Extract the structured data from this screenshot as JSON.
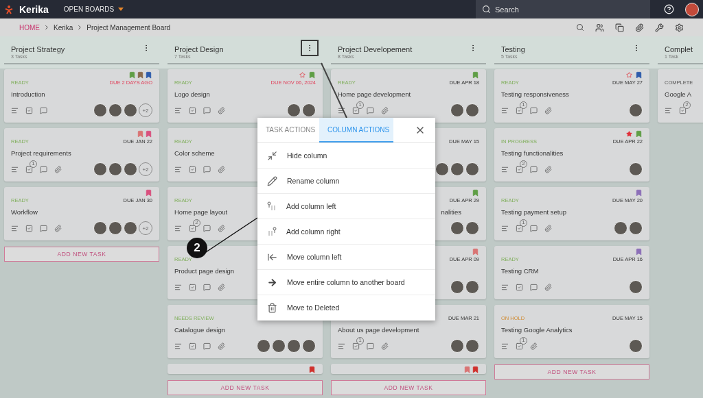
{
  "topbar": {
    "brand": "Kerika",
    "boards_menu": "OPEN BOARDS",
    "search": {
      "placeholder": "Search"
    }
  },
  "breadcrumb": [
    {
      "label": "HOME",
      "kind": "link"
    },
    {
      "label": "Kerika",
      "kind": "plain"
    },
    {
      "label": "Project Management Board",
      "kind": "plain"
    }
  ],
  "columns": [
    {
      "title": "Project Strategy",
      "count": "3 Tasks",
      "highlighted": false,
      "add_button": "ADD NEW TASK",
      "cards": [
        {
          "kind": "full",
          "bookmarks": [
            {
              "color": "#5f9e45"
            },
            {
              "color": "#8a6a4c"
            },
            {
              "color": "#2d5bab"
            }
          ],
          "status": {
            "label": "READY",
            "kind": "active"
          },
          "due": "DUE 2 DAYS AGO",
          "overdue": true,
          "title": "Introduction",
          "icons": [
            {
              "kind": "notes"
            },
            {
              "kind": "checklist"
            },
            {
              "kind": "chat"
            }
          ],
          "avatars": [
            {
              "kind": "photo"
            },
            {
              "kind": "photo"
            },
            {
              "kind": "photo"
            }
          ],
          "more": "+2"
        },
        {
          "kind": "full",
          "bookmarks": [
            {
              "color": "#d97474"
            },
            {
              "color": "#d9507e"
            }
          ],
          "status": {
            "label": "READY",
            "kind": "active"
          },
          "due": "DUE JAN 22",
          "overdue": false,
          "title": "Project requirements",
          "icons": [
            {
              "kind": "notes"
            },
            {
              "kind": "checklist"
            },
            {
              "kind": "chat"
            },
            {
              "kind": "attachment"
            }
          ],
          "checklist_count": "1",
          "avatars": [
            {
              "kind": "photo"
            },
            {
              "kind": "photo"
            },
            {
              "kind": "photo"
            }
          ],
          "more": "+2"
        },
        {
          "kind": "full",
          "bookmarks": [
            {
              "color": "#d9507e"
            }
          ],
          "status": {
            "label": "READY",
            "kind": "active"
          },
          "due": "DUE JAN 30",
          "overdue": false,
          "title": "Workflow",
          "icons": [
            {
              "kind": "notes"
            },
            {
              "kind": "checklist"
            },
            {
              "kind": "chat"
            },
            {
              "kind": "attachment"
            }
          ],
          "avatars": [
            {
              "kind": "photo"
            },
            {
              "kind": "photo"
            },
            {
              "kind": "photo"
            }
          ],
          "more": "+2"
        }
      ]
    },
    {
      "title": "Project Design",
      "count": "7 Tasks",
      "highlighted": true,
      "add_button": "ADD NEW TASK",
      "cards": [
        {
          "kind": "full",
          "star": {
            "kind": "outline"
          },
          "bookmarks": [
            {
              "color": "#5f9e45"
            }
          ],
          "status": {
            "label": "READY",
            "kind": "active"
          },
          "due": "DUE NOV 06, 2024",
          "overdue": true,
          "title": "Logo design",
          "icons": [
            {
              "kind": "notes"
            },
            {
              "kind": "checklist"
            },
            {
              "kind": "chat"
            },
            {
              "kind": "attachment"
            }
          ],
          "avatars": [
            {
              "kind": "photo"
            },
            {
              "kind": "photo"
            }
          ]
        },
        {
          "kind": "full",
          "status": {
            "label": "READY",
            "kind": "active"
          },
          "title": "Color scheme",
          "icons": [
            {
              "kind": "notes"
            },
            {
              "kind": "checklist"
            },
            {
              "kind": "chat"
            },
            {
              "kind": "attachment"
            }
          ]
        },
        {
          "kind": "full",
          "status": {
            "label": "READY",
            "kind": "active"
          },
          "title": "Home page layout",
          "icons": [
            {
              "kind": "notes"
            },
            {
              "kind": "checklist"
            },
            {
              "kind": "chat"
            },
            {
              "kind": "attachment"
            }
          ],
          "checklist_count": "2"
        },
        {
          "kind": "full",
          "status": {
            "label": "READY",
            "kind": "active"
          },
          "title": "Product page design",
          "icons": [
            {
              "kind": "notes"
            },
            {
              "kind": "checklist"
            },
            {
              "kind": "chat"
            },
            {
              "kind": "attachment"
            }
          ]
        },
        {
          "kind": "full",
          "status": {
            "label": "NEEDS REVIEW",
            "kind": "active"
          },
          "title": "Catalogue design",
          "icons": [
            {
              "kind": "notes"
            },
            {
              "kind": "checklist"
            },
            {
              "kind": "chat"
            },
            {
              "kind": "attachment"
            }
          ],
          "avatars": [
            {
              "kind": "photo"
            },
            {
              "kind": "photo"
            },
            {
              "kind": "photo"
            },
            {
              "kind": "photo"
            }
          ]
        },
        {
          "kind": "partial",
          "bookmarks": [
            {
              "color": "#d0312d"
            }
          ]
        }
      ]
    },
    {
      "title": "Project Developement",
      "count": "8 Tasks",
      "highlighted": false,
      "add_button": "ADD NEW TASK",
      "cards": [
        {
          "kind": "full",
          "bookmarks": [
            {
              "color": "#5f9e45"
            }
          ],
          "status": {
            "label": "READY",
            "kind": "active"
          },
          "due": "DUE APR 18",
          "overdue": false,
          "title": "Home page development",
          "icons": [
            {
              "kind": "notes"
            },
            {
              "kind": "checklist"
            },
            {
              "kind": "chat"
            },
            {
              "kind": "attachment"
            }
          ],
          "checklist_count": "1",
          "avatars": [
            {
              "kind": "photo"
            },
            {
              "kind": "photo"
            }
          ]
        },
        {
          "kind": "full",
          "due": "DUE MAY 15",
          "overdue": false,
          "avatars": [
            {
              "kind": "photo"
            },
            {
              "kind": "photo"
            },
            {
              "kind": "photo"
            }
          ]
        },
        {
          "kind": "full",
          "bookmarks": [
            {
              "color": "#5f9e45"
            }
          ],
          "due": "DUE APR 29",
          "overdue": false,
          "title_tail": "nalities",
          "avatars": [
            {
              "kind": "photo"
            },
            {
              "kind": "photo"
            }
          ]
        },
        {
          "kind": "full",
          "bookmarks": [
            {
              "color": "#d97474"
            }
          ],
          "due": "DUE APR 09",
          "overdue": false,
          "avatars": [
            {
              "kind": "photo"
            },
            {
              "kind": "photo"
            }
          ]
        },
        {
          "kind": "full",
          "due": "DUE MAR 21",
          "overdue": false,
          "title": "About us page development",
          "icons": [
            {
              "kind": "notes"
            },
            {
              "kind": "checklist"
            },
            {
              "kind": "chat"
            },
            {
              "kind": "attachment"
            }
          ],
          "checklist_count": "1",
          "avatars": [
            {
              "kind": "photo"
            },
            {
              "kind": "photo"
            }
          ]
        },
        {
          "kind": "partial",
          "bookmarks": [
            {
              "color": "#d97474"
            },
            {
              "color": "#d0312d"
            }
          ]
        }
      ]
    },
    {
      "title": "Testing",
      "count": "5 Tasks",
      "highlighted": false,
      "add_button": "ADD NEW TASK",
      "cards": [
        {
          "kind": "full",
          "star": {
            "kind": "outline"
          },
          "bookmarks": [
            {
              "color": "#2d5bab"
            }
          ],
          "status": {
            "label": "READY",
            "kind": "active"
          },
          "due": "DUE MAY 27",
          "overdue": false,
          "title": "Testing responsiveness",
          "icons": [
            {
              "kind": "notes"
            },
            {
              "kind": "checklist"
            },
            {
              "kind": "chat"
            },
            {
              "kind": "attachment"
            }
          ],
          "checklist_count": "1",
          "avatars": [
            {
              "kind": "photo"
            }
          ]
        },
        {
          "kind": "full",
          "star": {
            "kind": "filled"
          },
          "bookmarks": [
            {
              "color": "#5f9e45"
            }
          ],
          "status": {
            "label": "IN PROGRESS",
            "kind": "active"
          },
          "due": "DUE APR 22",
          "overdue": false,
          "title": "Testing functionalities",
          "icons": [
            {
              "kind": "notes"
            },
            {
              "kind": "checklist"
            },
            {
              "kind": "chat"
            },
            {
              "kind": "attachment"
            }
          ],
          "checklist_count": "2",
          "avatars": [
            {
              "kind": "photo"
            }
          ]
        },
        {
          "kind": "full",
          "bookmarks": [
            {
              "color": "#8c6fb8"
            }
          ],
          "status": {
            "label": "READY",
            "kind": "active"
          },
          "due": "DUE MAY 20",
          "overdue": false,
          "title": "Testing payment setup",
          "icons": [
            {
              "kind": "notes"
            },
            {
              "kind": "checklist"
            },
            {
              "kind": "chat"
            },
            {
              "kind": "attachment"
            }
          ],
          "checklist_count": "1",
          "avatars": [
            {
              "kind": "photo"
            },
            {
              "kind": "photo"
            }
          ]
        },
        {
          "kind": "full",
          "bookmarks": [
            {
              "color": "#8c6fb8"
            }
          ],
          "status": {
            "label": "READY",
            "kind": "active"
          },
          "due": "DUE APR 16",
          "overdue": false,
          "title": "Testing CRM",
          "icons": [
            {
              "kind": "notes"
            },
            {
              "kind": "checklist"
            },
            {
              "kind": "chat"
            },
            {
              "kind": "attachment"
            }
          ],
          "avatars": [
            {
              "kind": "photo"
            }
          ]
        },
        {
          "kind": "full",
          "status": {
            "label": "ON HOLD",
            "kind": "hold"
          },
          "due": "DUE MAY 15",
          "overdue": false,
          "title": "Testing Google Analytics",
          "icons": [
            {
              "kind": "notes"
            },
            {
              "kind": "checklist"
            },
            {
              "kind": "attachment"
            }
          ],
          "checklist_count": "1",
          "avatars": [
            {
              "kind": "photo"
            }
          ]
        }
      ]
    },
    {
      "title": "Complet",
      "count": "1 Task",
      "cards": [
        {
          "kind": "full",
          "status": {
            "label": "COMPLETE",
            "kind": "done"
          },
          "title": "Google A",
          "icons": [
            {
              "kind": "notes"
            },
            {
              "kind": "checklist"
            }
          ],
          "checklist_count": "2"
        }
      ]
    }
  ],
  "menu": {
    "tabs": [
      {
        "label": "TASK ACTIONS",
        "selected": false
      },
      {
        "label": "COLUMN ACTIONS",
        "selected": true
      }
    ],
    "items": [
      {
        "kind": "hide",
        "label": "Hide column"
      },
      {
        "kind": "rename",
        "label": "Rename column"
      },
      {
        "kind": "add_left",
        "label": "Add column left"
      },
      {
        "kind": "add_right",
        "label": "Add column right"
      },
      {
        "kind": "move_left",
        "label": "Move column left"
      },
      {
        "kind": "move_board",
        "label": "Move entire column to another board"
      },
      {
        "kind": "delete",
        "label": "Move to Deleted"
      }
    ]
  },
  "annotation": {
    "label": "2"
  }
}
